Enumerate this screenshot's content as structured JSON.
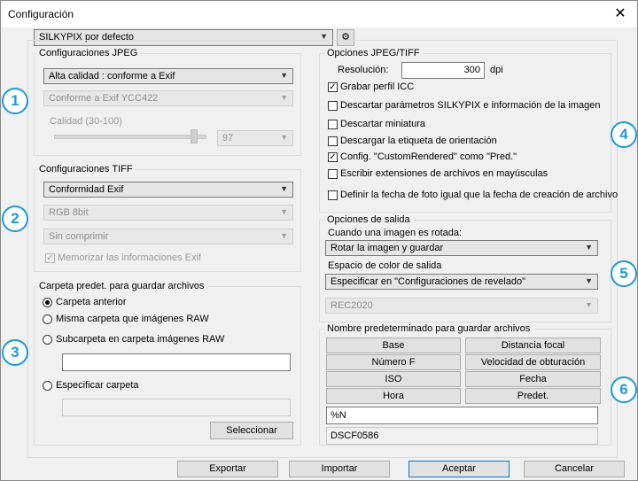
{
  "window": {
    "title": "Configuración",
    "close_symbol": "✕"
  },
  "preset": {
    "value": "SILKYPIX por defecto",
    "gear_symbol": "⚙"
  },
  "jpeg": {
    "title": "Configuraciones JPEG",
    "quality_combo": "Alta calidad : conforme a Exif",
    "format_combo": "Conforme a Exif YCC422",
    "quality_label": "Calidad (30-100)",
    "quality_value": "97",
    "quality_level": 0.97
  },
  "tiff": {
    "title": "Configuraciones TIFF",
    "conformity": "Conformidad Exif",
    "bits": "RGB 8bit",
    "compression": "Sin comprimir",
    "memorize_exif": "Memorizar las informaciones Exif"
  },
  "folder": {
    "title": "Carpeta predet. para guardar archivos",
    "options": [
      "Carpeta anterior",
      "Misma carpeta que imágenes RAW",
      "Subcarpeta en carpeta imágenes RAW",
      "Especificar carpeta"
    ],
    "subfolder_value": "",
    "specify_value": "",
    "select_button": "Seleccionar"
  },
  "jpeg_tiff_options": {
    "title": "Opciones JPEG/TIFF",
    "resolution_label": "Resolución:",
    "resolution_value": "300",
    "resolution_unit": "dpi",
    "checks": [
      "Grabar perfil ICC",
      "Descartar parámetros SILKYPIX e información de la imagen",
      "Descartar miniatura",
      "Descargar la etiqueta de orientación",
      "Config. \"CustomRendered\" como \"Pred.\"",
      "Escribir extensiones de archivos en mayúsculas",
      "Definir la fecha de foto igual que la fecha de creación de archivo"
    ]
  },
  "output": {
    "title": "Opciones de salida",
    "rotated_label": "Cuando una imagen es rotada:",
    "rotated_value": "Rotar la imagen y guardar",
    "colorspace_label": "Espacio de color de salida",
    "colorspace_value": "Especificar en \"Configuraciones de revelado\"",
    "colorspace_disabled": "REC2020"
  },
  "filename": {
    "title": "Nombre predeterminado para guardar archivos",
    "tokens": [
      "Base",
      "Distancia focal",
      "Número F",
      "Velocidad de obturación",
      "ISO",
      "Fecha",
      "Hora",
      "Predet."
    ],
    "pattern": "%N",
    "preview": "DSCF0586"
  },
  "footer": {
    "export": "Exportar",
    "import": "Importar",
    "accept": "Aceptar",
    "cancel": "Cancelar"
  },
  "badges": [
    "1",
    "2",
    "3",
    "4",
    "5",
    "6"
  ],
  "accent_color": "#1e9ad6"
}
